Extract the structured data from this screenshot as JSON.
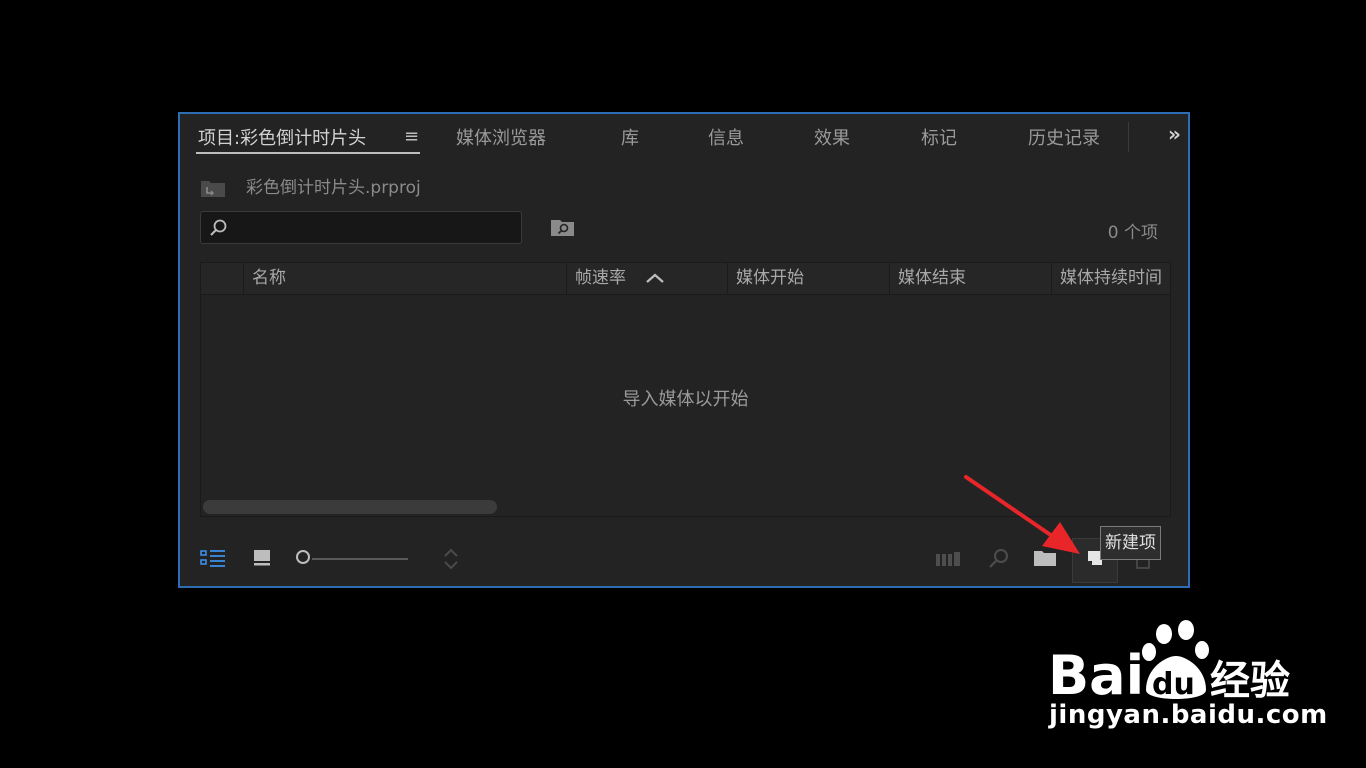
{
  "panel": {
    "tabs": [
      {
        "label": "项目:彩色倒计时片头",
        "active": true
      },
      {
        "label": "媒体浏览器"
      },
      {
        "label": "库"
      },
      {
        "label": "信息"
      },
      {
        "label": "效果"
      },
      {
        "label": "标记"
      },
      {
        "label": "历史记录"
      }
    ],
    "menu_glyph": "≡",
    "overflow_glyph": "»"
  },
  "project": {
    "file_name": "彩色倒计时片头.prproj",
    "search_placeholder": "",
    "item_count": "0 个项"
  },
  "table": {
    "columns": [
      "名称",
      "帧速率",
      "媒体开始",
      "媒体结束",
      "媒体持续时间"
    ],
    "sort_column": "帧速率",
    "empty_message": "导入媒体以开始"
  },
  "toolbar": {
    "tooltip": "新建项",
    "icons": [
      "list-view-icon",
      "icon-view-icon",
      "zoom-slider",
      "sort-icon",
      "automate-to-sequence-icon",
      "find-icon",
      "new-bin-icon",
      "new-item-icon",
      "clear-icon"
    ]
  },
  "watermark": {
    "brand": "Bai du 经验",
    "url": "jingyan.baidu.com"
  },
  "colors": {
    "panel_border": "#2d6db3",
    "panel_bg": "#232323",
    "accent_blue": "#3a8ee6",
    "annotation_red": "#e8262a"
  }
}
